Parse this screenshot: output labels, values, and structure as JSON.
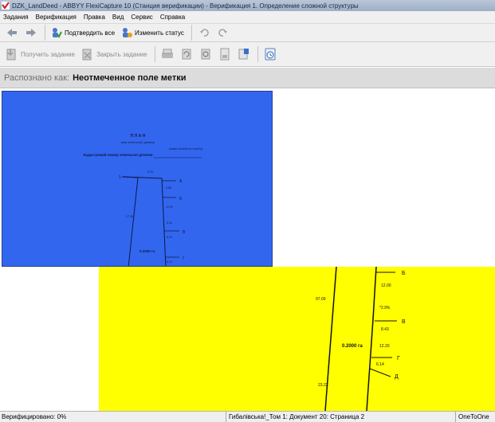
{
  "window": {
    "title": "DZK_LandDeed - ABBYY FlexiCapture 10 (Станция верификации) - Верификация 1. Определение сложной структуры"
  },
  "menu": [
    "Задания",
    "Верификация",
    "Правка",
    "Вид",
    "Сервис",
    "Справка"
  ],
  "toolbar1": {
    "back_icon": "arrow-left-icon",
    "forward_icon": "arrow-right-icon",
    "confirm_all": "Подтвердить все",
    "change_status": "Изменить статус",
    "undo_icon": "undo-icon",
    "redo_icon": "redo-icon"
  },
  "toolbar2": {
    "get_task": "Получить задание",
    "close_task": "Закрыть задание"
  },
  "recognized": {
    "label": "Распознано как:",
    "value": "Неотмеченное поле метки"
  },
  "doc_blue": {
    "heading": "П Л А Н",
    "subheading": "меж земельної ділянки",
    "note": "(назва населеного пункту)",
    "cadastre": "Кадастровий номер земельної ділянки",
    "points": [
      "1",
      "А",
      "Б",
      "В",
      "Г"
    ],
    "segments": [
      "6.20",
      "0.58",
      "12.00",
      "17.26",
      "8.43",
      "6.13",
      "6.14"
    ],
    "area": "0.2000 га"
  },
  "doc_yellow": {
    "points": [
      "Б",
      "В",
      "Г",
      "Д"
    ],
    "segments": [
      "12.00",
      "*2.9%",
      "8.43",
      "12.20",
      "6.14",
      "97.09",
      "23.22"
    ],
    "area": "0.2000 га"
  },
  "status": {
    "verified": "Верифицировано: 0%",
    "document": "Гибалівська!_Том 1: Документ 20: Страница 2",
    "mode": "OneToOne"
  },
  "colors": {
    "blue_region": "#3366ee",
    "yellow_region": "#ffff00",
    "accent_red": "#cc1b1b"
  }
}
